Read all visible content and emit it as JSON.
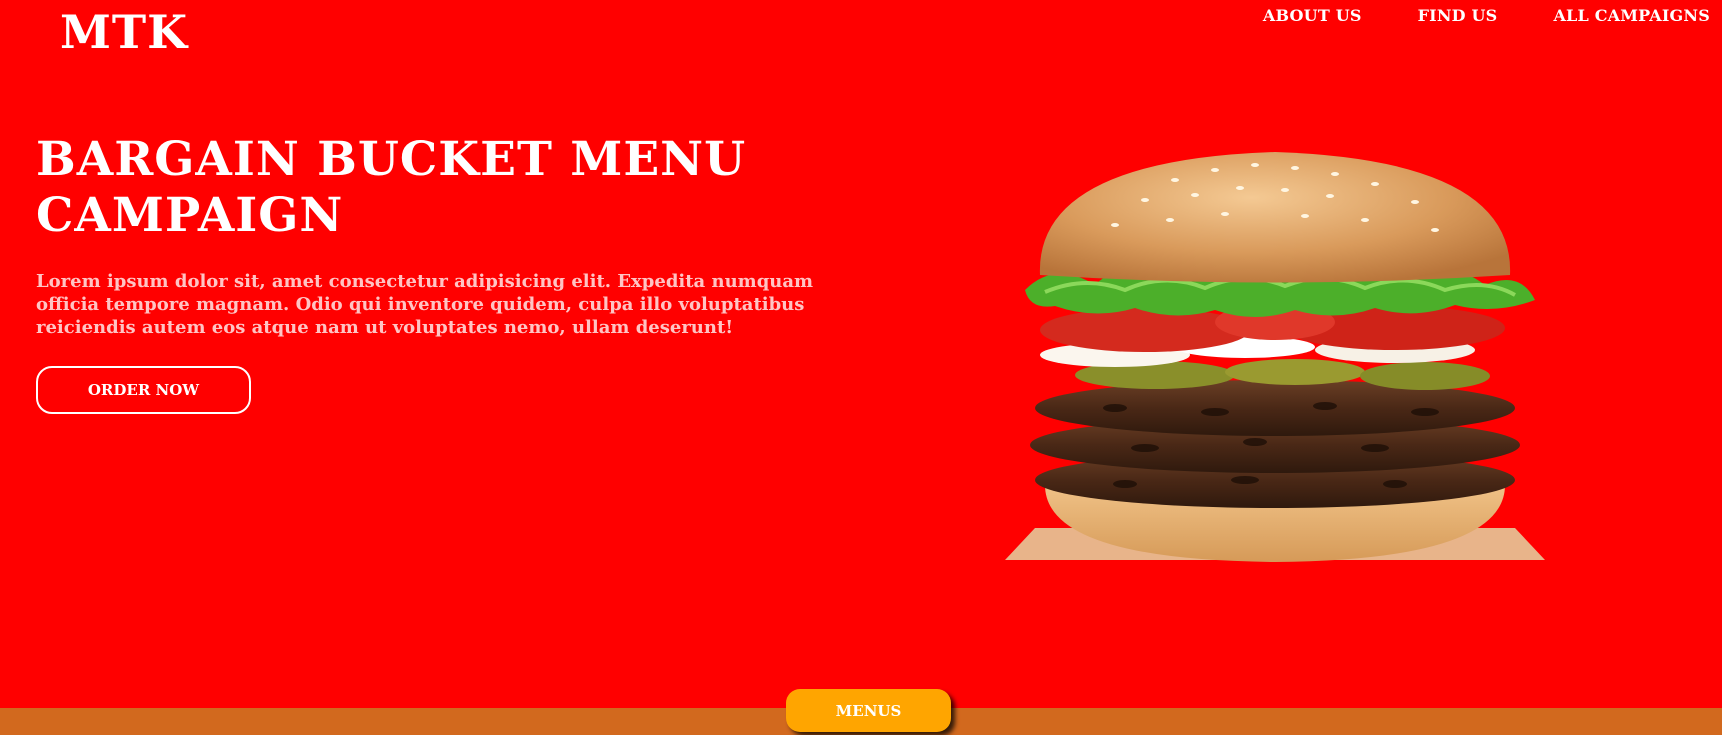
{
  "header": {
    "logo": "MTK",
    "nav": [
      {
        "label": "ABOUT US"
      },
      {
        "label": "FIND US"
      },
      {
        "label": "ALL CAMPAIGNS"
      }
    ]
  },
  "hero": {
    "title": "BARGAIN BUCKET MENU CAMPAIGN",
    "description": "Lorem ipsum dolor sit, amet consectetur adipisicing elit. Expedita numquam officia tempore magnam. Odio qui inventore quidem, culpa illo voluptatibus reiciendis autem eos atque nam ut voluptates nemo, ullam deserunt!",
    "cta_label": "ORDER NOW"
  },
  "footer": {
    "menus_label": "MENUS"
  },
  "colors": {
    "background": "#ff0000",
    "description_text": "#ffc4c4",
    "bottom_strip": "#d2691e",
    "menus_button": "#ffa500"
  },
  "image": {
    "subject": "burger-image"
  }
}
